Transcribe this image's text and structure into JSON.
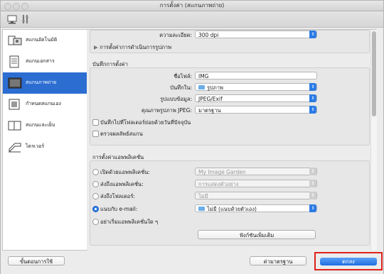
{
  "window": {
    "title": "การตั้งค่า (สแกนภาพถ่าย)"
  },
  "sidebar": {
    "items": [
      {
        "label": "สแกนอัตโนมัติ",
        "icon": "auto-scan-icon",
        "selected": false
      },
      {
        "label": "สแกนเอกสาร",
        "icon": "document-icon",
        "selected": false
      },
      {
        "label": "สแกนภาพถ่าย",
        "icon": "photo-icon",
        "selected": true
      },
      {
        "label": "กำหนดสแกนเอง",
        "icon": "custom-scan-icon",
        "selected": false
      },
      {
        "label": "สแกนและเย็บ",
        "icon": "stitch-icon",
        "selected": false
      },
      {
        "label": "ไดรเวอร์",
        "icon": "driver-icon",
        "selected": false
      }
    ]
  },
  "scan_options": {
    "resolution_label": "ความละเอียด:",
    "resolution_value": "300 dpi",
    "image_processing_label": "การตั้งค่าการดำเนินการรูปภาพ"
  },
  "save_settings": {
    "section_title": "บันทึกการตั้งค่า",
    "filename_label": "ชื่อไฟล์:",
    "filename_value": "IMG",
    "save_in_label": "บันทึกใน:",
    "save_in_value": "รูปภาพ",
    "data_format_label": "รูปแบบข้อมูล:",
    "data_format_value": "JPEG/Exif",
    "jpeg_quality_label": "คุณภาพรูปภาพ JPEG:",
    "jpeg_quality_value": "มาตรฐาน",
    "subfolder_checkbox": "บันทึกไปที่โฟลเดอร์ย่อยด้วยวันที่ปัจจุบัน",
    "check_scan_checkbox": "ตรวจผลลัพธ์สแกน"
  },
  "app_settings": {
    "section_title": "การตั้งค่าแอพพลิเคชั่น",
    "options": [
      {
        "label": "เปิดด้วยแอพพลิเคชั่น:",
        "value": "My Image Garden",
        "checked": false,
        "enabled": false
      },
      {
        "label": "ส่งถึงแอพพลิเคชั่น:",
        "value": "การแสดงตัวอย่าง",
        "checked": false,
        "enabled": false
      },
      {
        "label": "ส่งถึงโฟลเดอร์:",
        "value": "ไม่มี",
        "checked": false,
        "enabled": false
      },
      {
        "label": "แนบกับ e-mail:",
        "value": "ไม่มี (แนบด้วยตัวเอง)",
        "checked": true,
        "enabled": true
      },
      {
        "label": "อย่าเริ่มแอพพลิเคชั่นใด ๆ",
        "value": "",
        "checked": false,
        "enabled": false
      }
    ],
    "more_functions_button": "ฟังก์ชันเพิ่มเติม"
  },
  "footer": {
    "instructions_button": "ขั้นตอนการใช้",
    "defaults_button": "ค่ามาตรฐาน",
    "ok_button": "ตกลง"
  },
  "colors": {
    "accent": "#2b7be5",
    "sidebar_selected": "#2c6dd2",
    "highlight_frame": "#e0201b"
  }
}
